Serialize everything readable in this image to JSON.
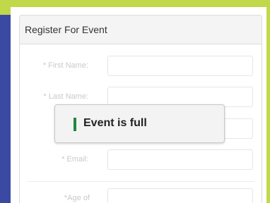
{
  "panel": {
    "title": "Register For Event"
  },
  "form": {
    "fields": [
      {
        "label": "* First Name:",
        "value": ""
      },
      {
        "label": "* Last Name:",
        "value": ""
      },
      {
        "label": "",
        "value": ""
      },
      {
        "label": "* Email:",
        "value": ""
      },
      {
        "label": "*Age of",
        "value": ""
      }
    ]
  },
  "toast": {
    "message": "Event is full",
    "accent_color": "#1e8a3a"
  },
  "colors": {
    "background_top": "#c1d84a",
    "background_left": "#3a4aa3"
  }
}
